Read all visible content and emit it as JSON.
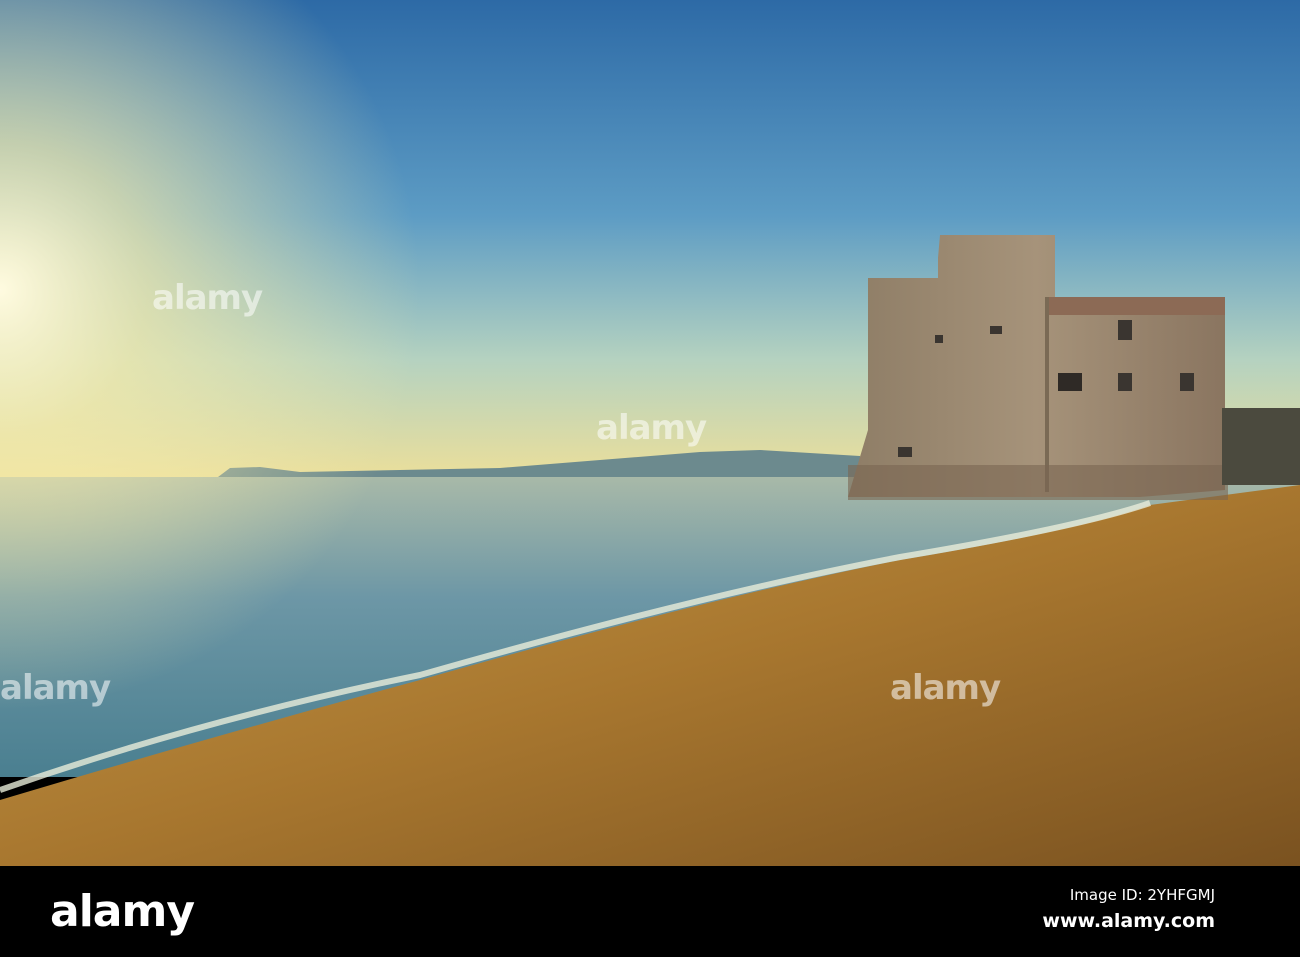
{
  "photo": {
    "subject": "Torre Mozza / coastal watchtower on beach at sunset"
  },
  "watermark": {
    "text": "alamy"
  },
  "footer": {
    "logo": "alamy",
    "image_id": "Image ID: 2YHFGMJ",
    "website": "www.alamy.com"
  },
  "colors": {
    "sky_top": "#2d6aa6",
    "horizon": "#ecdf9a",
    "sea": "#5f8ea0",
    "sand": "#a8772f",
    "tower": "#9c8a70"
  }
}
